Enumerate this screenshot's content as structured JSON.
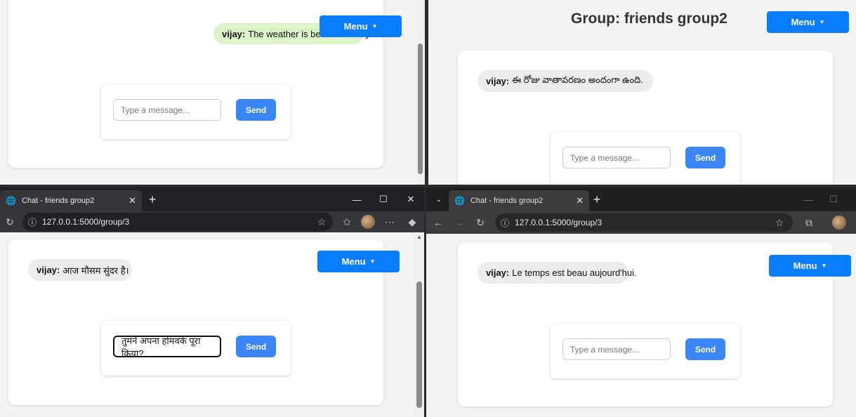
{
  "group_title": "Group: friends group2",
  "menu_label": "Menu",
  "menu_caret": "▼",
  "send_label": "Send",
  "input_placeholder": "Type a message...",
  "sender": "vijay:",
  "messages": {
    "top_left": "The weather is beautiful today.",
    "top_right": "ఈ రోజు వాతావరణం అందంగా ఉంది.",
    "bottom_left": "आज मौसम सुंदर है।",
    "bottom_right": "Le temps est beau aujourd'hui."
  },
  "bottom_left_input_value": "तुमने अपना होमवर्क पूरा किया?",
  "browser_left": {
    "tab_title": "Chat - friends group2",
    "url": "127.0.0.1:5000/group/3",
    "new_tab": "+",
    "close": "✕"
  },
  "browser_right": {
    "tab_title": "Chat - friends group2",
    "url": "127.0.0.1:5000/group/3",
    "new_tab": "+",
    "close": "✕"
  }
}
